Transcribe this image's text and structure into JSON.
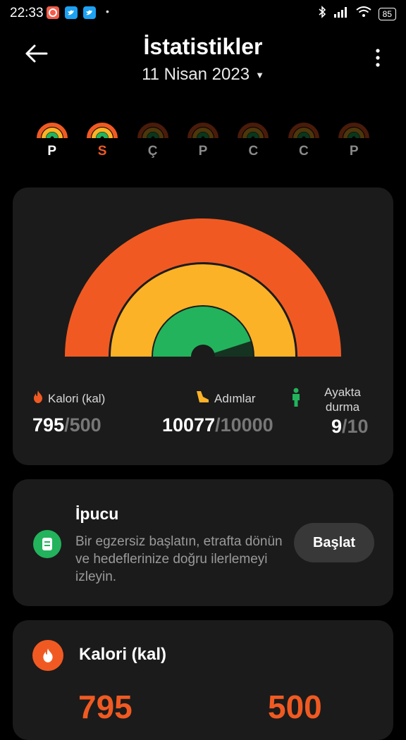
{
  "status_bar": {
    "time": "22:33",
    "dot": "•",
    "battery": "85"
  },
  "header": {
    "title": "İstatistikler",
    "date": "11 Nisan 2023"
  },
  "week": [
    {
      "label": "P",
      "state": "active"
    },
    {
      "label": "S",
      "state": "today"
    },
    {
      "label": "Ç",
      "state": "dim"
    },
    {
      "label": "P",
      "state": "dim"
    },
    {
      "label": "C",
      "state": "dim"
    },
    {
      "label": "C",
      "state": "dim"
    },
    {
      "label": "P",
      "state": "dim"
    }
  ],
  "summary": {
    "calories": {
      "label": "Kalori (kal)",
      "value": "795",
      "target": "/500"
    },
    "steps": {
      "label": "Adımlar",
      "value": "10077",
      "target": "/10000"
    },
    "standing": {
      "label": "Ayakta durma",
      "value": "9",
      "target": "/10"
    },
    "ring_progress": {
      "calories": 1.0,
      "steps": 1.0,
      "standing": 0.9
    }
  },
  "tip": {
    "title": "İpucu",
    "text": "Bir egzersiz başlatın, etrafta dönün ve hedeflerinize doğru ilerlemeyi izleyin.",
    "button": "Başlat"
  },
  "calorie_card": {
    "title": "Kalori (kal)",
    "value": "795",
    "target": "500"
  },
  "colors": {
    "calories": "#f05a22",
    "steps": "#fbb227",
    "standing": "#23b35c",
    "card": "#1b1b1b",
    "background": "#000000"
  }
}
